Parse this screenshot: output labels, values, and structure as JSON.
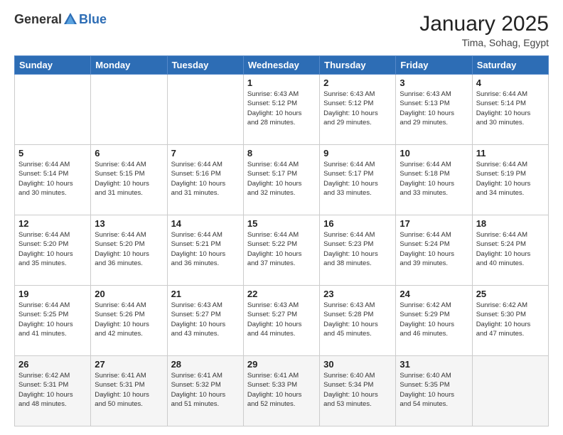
{
  "logo": {
    "general": "General",
    "blue": "Blue"
  },
  "header": {
    "month": "January 2025",
    "location": "Tima, Sohag, Egypt"
  },
  "weekdays": [
    "Sunday",
    "Monday",
    "Tuesday",
    "Wednesday",
    "Thursday",
    "Friday",
    "Saturday"
  ],
  "weeks": [
    [
      {
        "day": "",
        "info": ""
      },
      {
        "day": "",
        "info": ""
      },
      {
        "day": "",
        "info": ""
      },
      {
        "day": "1",
        "info": "Sunrise: 6:43 AM\nSunset: 5:12 PM\nDaylight: 10 hours\nand 28 minutes."
      },
      {
        "day": "2",
        "info": "Sunrise: 6:43 AM\nSunset: 5:12 PM\nDaylight: 10 hours\nand 29 minutes."
      },
      {
        "day": "3",
        "info": "Sunrise: 6:43 AM\nSunset: 5:13 PM\nDaylight: 10 hours\nand 29 minutes."
      },
      {
        "day": "4",
        "info": "Sunrise: 6:44 AM\nSunset: 5:14 PM\nDaylight: 10 hours\nand 30 minutes."
      }
    ],
    [
      {
        "day": "5",
        "info": "Sunrise: 6:44 AM\nSunset: 5:14 PM\nDaylight: 10 hours\nand 30 minutes."
      },
      {
        "day": "6",
        "info": "Sunrise: 6:44 AM\nSunset: 5:15 PM\nDaylight: 10 hours\nand 31 minutes."
      },
      {
        "day": "7",
        "info": "Sunrise: 6:44 AM\nSunset: 5:16 PM\nDaylight: 10 hours\nand 31 minutes."
      },
      {
        "day": "8",
        "info": "Sunrise: 6:44 AM\nSunset: 5:17 PM\nDaylight: 10 hours\nand 32 minutes."
      },
      {
        "day": "9",
        "info": "Sunrise: 6:44 AM\nSunset: 5:17 PM\nDaylight: 10 hours\nand 33 minutes."
      },
      {
        "day": "10",
        "info": "Sunrise: 6:44 AM\nSunset: 5:18 PM\nDaylight: 10 hours\nand 33 minutes."
      },
      {
        "day": "11",
        "info": "Sunrise: 6:44 AM\nSunset: 5:19 PM\nDaylight: 10 hours\nand 34 minutes."
      }
    ],
    [
      {
        "day": "12",
        "info": "Sunrise: 6:44 AM\nSunset: 5:20 PM\nDaylight: 10 hours\nand 35 minutes."
      },
      {
        "day": "13",
        "info": "Sunrise: 6:44 AM\nSunset: 5:20 PM\nDaylight: 10 hours\nand 36 minutes."
      },
      {
        "day": "14",
        "info": "Sunrise: 6:44 AM\nSunset: 5:21 PM\nDaylight: 10 hours\nand 36 minutes."
      },
      {
        "day": "15",
        "info": "Sunrise: 6:44 AM\nSunset: 5:22 PM\nDaylight: 10 hours\nand 37 minutes."
      },
      {
        "day": "16",
        "info": "Sunrise: 6:44 AM\nSunset: 5:23 PM\nDaylight: 10 hours\nand 38 minutes."
      },
      {
        "day": "17",
        "info": "Sunrise: 6:44 AM\nSunset: 5:24 PM\nDaylight: 10 hours\nand 39 minutes."
      },
      {
        "day": "18",
        "info": "Sunrise: 6:44 AM\nSunset: 5:24 PM\nDaylight: 10 hours\nand 40 minutes."
      }
    ],
    [
      {
        "day": "19",
        "info": "Sunrise: 6:44 AM\nSunset: 5:25 PM\nDaylight: 10 hours\nand 41 minutes."
      },
      {
        "day": "20",
        "info": "Sunrise: 6:44 AM\nSunset: 5:26 PM\nDaylight: 10 hours\nand 42 minutes."
      },
      {
        "day": "21",
        "info": "Sunrise: 6:43 AM\nSunset: 5:27 PM\nDaylight: 10 hours\nand 43 minutes."
      },
      {
        "day": "22",
        "info": "Sunrise: 6:43 AM\nSunset: 5:27 PM\nDaylight: 10 hours\nand 44 minutes."
      },
      {
        "day": "23",
        "info": "Sunrise: 6:43 AM\nSunset: 5:28 PM\nDaylight: 10 hours\nand 45 minutes."
      },
      {
        "day": "24",
        "info": "Sunrise: 6:42 AM\nSunset: 5:29 PM\nDaylight: 10 hours\nand 46 minutes."
      },
      {
        "day": "25",
        "info": "Sunrise: 6:42 AM\nSunset: 5:30 PM\nDaylight: 10 hours\nand 47 minutes."
      }
    ],
    [
      {
        "day": "26",
        "info": "Sunrise: 6:42 AM\nSunset: 5:31 PM\nDaylight: 10 hours\nand 48 minutes."
      },
      {
        "day": "27",
        "info": "Sunrise: 6:41 AM\nSunset: 5:31 PM\nDaylight: 10 hours\nand 50 minutes."
      },
      {
        "day": "28",
        "info": "Sunrise: 6:41 AM\nSunset: 5:32 PM\nDaylight: 10 hours\nand 51 minutes."
      },
      {
        "day": "29",
        "info": "Sunrise: 6:41 AM\nSunset: 5:33 PM\nDaylight: 10 hours\nand 52 minutes."
      },
      {
        "day": "30",
        "info": "Sunrise: 6:40 AM\nSunset: 5:34 PM\nDaylight: 10 hours\nand 53 minutes."
      },
      {
        "day": "31",
        "info": "Sunrise: 6:40 AM\nSunset: 5:35 PM\nDaylight: 10 hours\nand 54 minutes."
      },
      {
        "day": "",
        "info": ""
      }
    ]
  ]
}
